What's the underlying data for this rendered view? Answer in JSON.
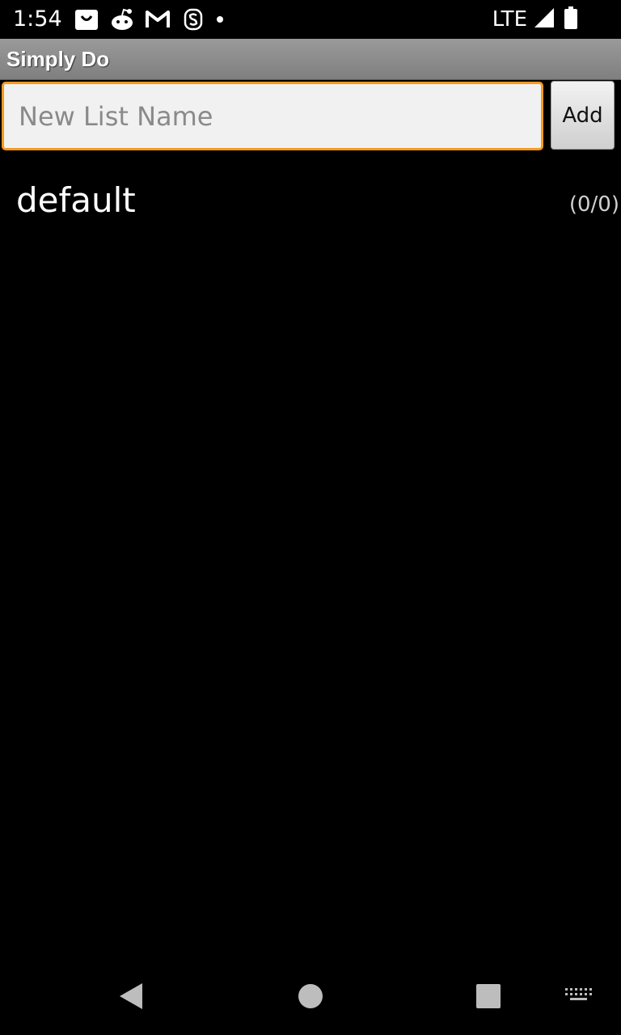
{
  "status_bar": {
    "time": "1:54",
    "network": "LTE",
    "icons": [
      "shopping-bag-icon",
      "reddit-icon",
      "gmail-icon",
      "app-s-icon",
      "notification-dot-icon",
      "signal-icon",
      "battery-icon"
    ]
  },
  "app": {
    "title": "Simply Do"
  },
  "new_list": {
    "placeholder": "New List Name",
    "value": "",
    "add_label": "Add",
    "focus_color": "#f39a1e"
  },
  "lists": [
    {
      "name": "default",
      "count": "(0/0)"
    }
  ],
  "nav_bar": {
    "icons": [
      "back-icon",
      "home-icon",
      "recents-icon",
      "keyboard-icon"
    ]
  }
}
